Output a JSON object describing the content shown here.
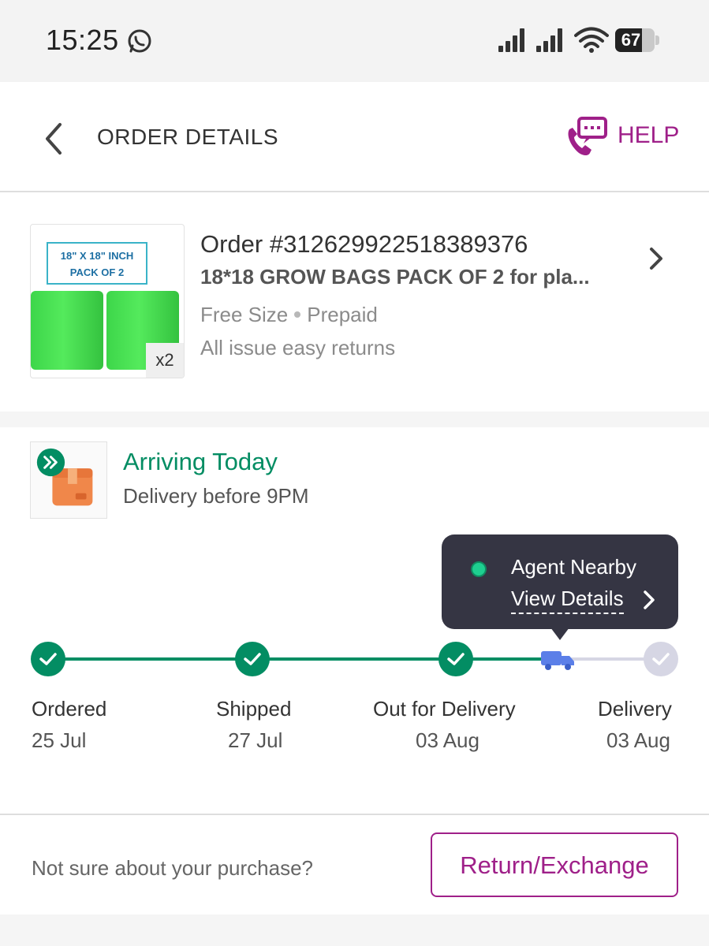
{
  "status_bar": {
    "time": "15:25",
    "battery": "67",
    "battery_level": 0.67
  },
  "header": {
    "title": "ORDER DETAILS",
    "help_label": "HELP",
    "accent_color": "#9f2089"
  },
  "order": {
    "number": "Order #312629922518389376",
    "product_name": "18*18 GROW BAGS PACK OF 2 for pla...",
    "size": "Free Size",
    "payment": "Prepaid",
    "returns_note": "All issue easy returns",
    "quantity": "x2",
    "thumb_text_line1": "18\" X 18\" INCH",
    "thumb_text_line2": "PACK OF 2"
  },
  "delivery": {
    "status_title": "Arriving Today",
    "status_subtitle": "Delivery before 9PM",
    "status_color": "#038d63",
    "tooltip": {
      "agent_label": "Agent Nearby",
      "details_link": "View Details"
    },
    "steps": [
      {
        "label": "Ordered",
        "date": "25 Jul",
        "state": "done"
      },
      {
        "label": "Shipped",
        "date": "27 Jul",
        "state": "done"
      },
      {
        "label": "Out for Delivery",
        "date": "03 Aug",
        "state": "done"
      },
      {
        "label": "Delivery",
        "date": "03 Aug",
        "state": "pending"
      }
    ]
  },
  "footer": {
    "prompt": "Not sure about your purchase?",
    "return_button": "Return/Exchange"
  }
}
